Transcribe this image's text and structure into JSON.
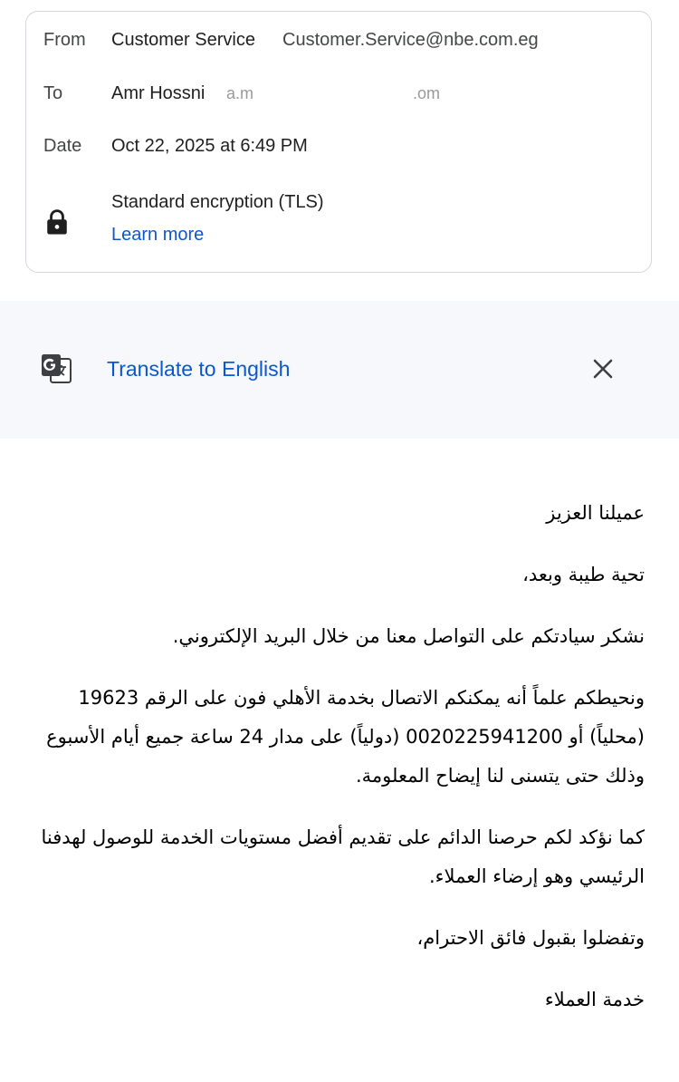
{
  "header": {
    "from_label": "From",
    "from_name": "Customer Service",
    "from_email": "Customer.Service@nbe.com.eg",
    "to_label": "To",
    "to_name": "Amr Hossni",
    "to_email_redacted_start": "a.m",
    "to_email_redacted_end": ".om",
    "date_label": "Date",
    "date_value": "Oct 22, 2025 at 6:49 PM",
    "encryption_text": "Standard encryption (TLS)",
    "learn_more": "Learn more"
  },
  "translate_bar": {
    "label": "Translate to English",
    "icon": "google-translate-icon",
    "close_icon": "close-icon"
  },
  "body": {
    "greeting": "عميلنا العزيز",
    "salutation": "تحية طيبة وبعد،",
    "thanks": "نشكر سيادتكم على التواصل معنا من خلال البريد الإلكتروني.",
    "info": "ونحيطكم علماً أنه يمكنكم الاتصال بخدمة الأهلي فون على الرقم 19623 (محلياً) أو 0020225941200 (دولياً) على مدار 24 ساعة جميع أيام الأسبوع وذلك حتى يتسنى لنا إيضاح المعلومة.",
    "commitment": "كما نؤكد لكم حرصنا الدائم على تقديم أفضل مستويات الخدمة للوصول لهدفنا الرئيسي وهو إرضاء العملاء.",
    "closing": "وتفضلوا بقبول فائق الاحترام،",
    "signature": "خدمة العملاء"
  },
  "colors": {
    "link": "#0b57d0",
    "translate_bar_bg": "#f6f8fc",
    "card_border": "#d3d6db"
  }
}
